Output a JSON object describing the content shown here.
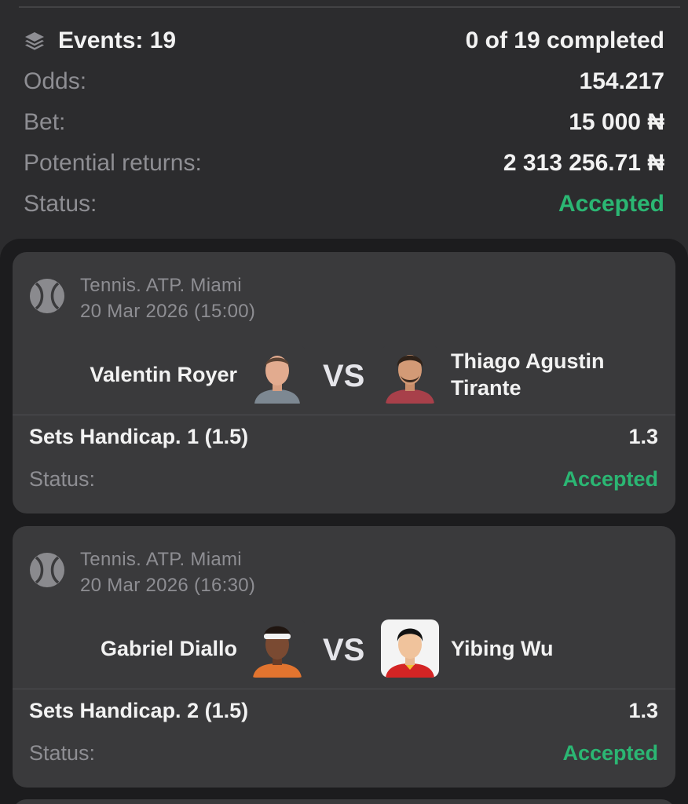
{
  "summary": {
    "events_label": "Events: 19",
    "completed": "0 of 19 completed",
    "odds_label": "Odds:",
    "odds_value": "154.217",
    "bet_label": "Bet:",
    "bet_value": "15 000 ₦",
    "returns_label": "Potential returns:",
    "returns_value": "2 313 256.71 ₦",
    "status_label": "Status:",
    "status_value": "Accepted",
    "accent_color": "#2bb673"
  },
  "events": [
    {
      "competition": "Tennis. ATP. Miami",
      "datetime": "20 Mar 2026 (15:00)",
      "player1": "Valentin Royer",
      "player2": "Thiago Agustin Tirante",
      "vs": "VS",
      "market": "Sets Handicap. 1 (1.5)",
      "odds": "1.3",
      "status_label": "Status:",
      "status": "Accepted"
    },
    {
      "competition": "Tennis. ATP. Miami",
      "datetime": "20 Mar 2026 (16:30)",
      "player1": "Gabriel Diallo",
      "player2": "Yibing Wu",
      "vs": "VS",
      "market": "Sets Handicap. 2 (1.5)",
      "odds": "1.3",
      "status_label": "Status:",
      "status": "Accepted"
    }
  ],
  "icons": {
    "summary": "layers-icon",
    "sport": "tennis-ball-icon"
  }
}
